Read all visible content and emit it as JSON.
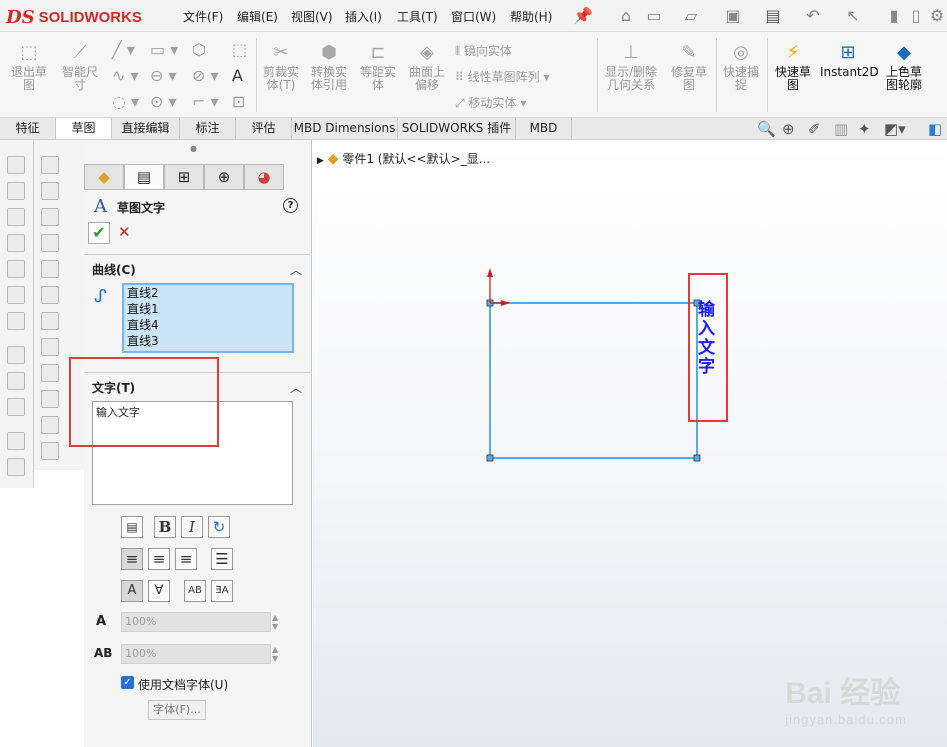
{
  "app": {
    "brand": "SOLIDWORKS",
    "brand_prefix": "DS"
  },
  "menu": [
    "文件(F)",
    "编辑(E)",
    "视图(V)",
    "插入(I)",
    "工具(T)",
    "窗口(W)",
    "帮助(H)"
  ],
  "ribbon": {
    "exit_sketch": "退出草\n图",
    "smart_dim": "智能尺\n寸",
    "trim": "剪裁实\n体(T)",
    "convert": "转换实\n体引用",
    "offset": "等距实\n体",
    "surface_offset": "曲面上\n偏移",
    "mirror": "镜向实体",
    "linear_pattern": "线性草图阵列",
    "move": "移动实体",
    "show_relations": "显示/删除\n几何关系",
    "repair": "修复草\n图",
    "quick_snap": "快速捕\n捉",
    "rapid_sketch": "快速草\n图",
    "instant2d": "Instant2D",
    "shaded_sketch": "上色草\n图轮廓"
  },
  "tabs": [
    "特征",
    "草图",
    "直接编辑",
    "标注",
    "评估",
    "MBD Dimensions",
    "SOLIDWORKS 插件",
    "MBD"
  ],
  "active_tab": "草图",
  "tree": {
    "part": "零件1 (默认<<默认>_显..."
  },
  "panel": {
    "title": "草图文字",
    "help": "?",
    "ok": "✔",
    "cancel": "✕",
    "curves_label": "曲线(C)",
    "curves": [
      "直线2",
      "直线1",
      "直线4",
      "直线3"
    ],
    "text_label": "文字(T)",
    "text_value": "输入文字",
    "width_value": "100%",
    "spacing_value": "100%",
    "use_doc_font": "使用文档字体(U)",
    "font_button": "字体(F)..."
  },
  "sketch": {
    "text": "输入文字",
    "text_color": "#1a1aff",
    "line_color": "#5aa9e6"
  },
  "watermark": {
    "main": "Bai 经验",
    "sub": "jingyan.baidu.com"
  },
  "colors": {
    "highlight_box": "#e23b3b",
    "list_bg": "#cce4f7",
    "brand": "#d12a2a"
  }
}
